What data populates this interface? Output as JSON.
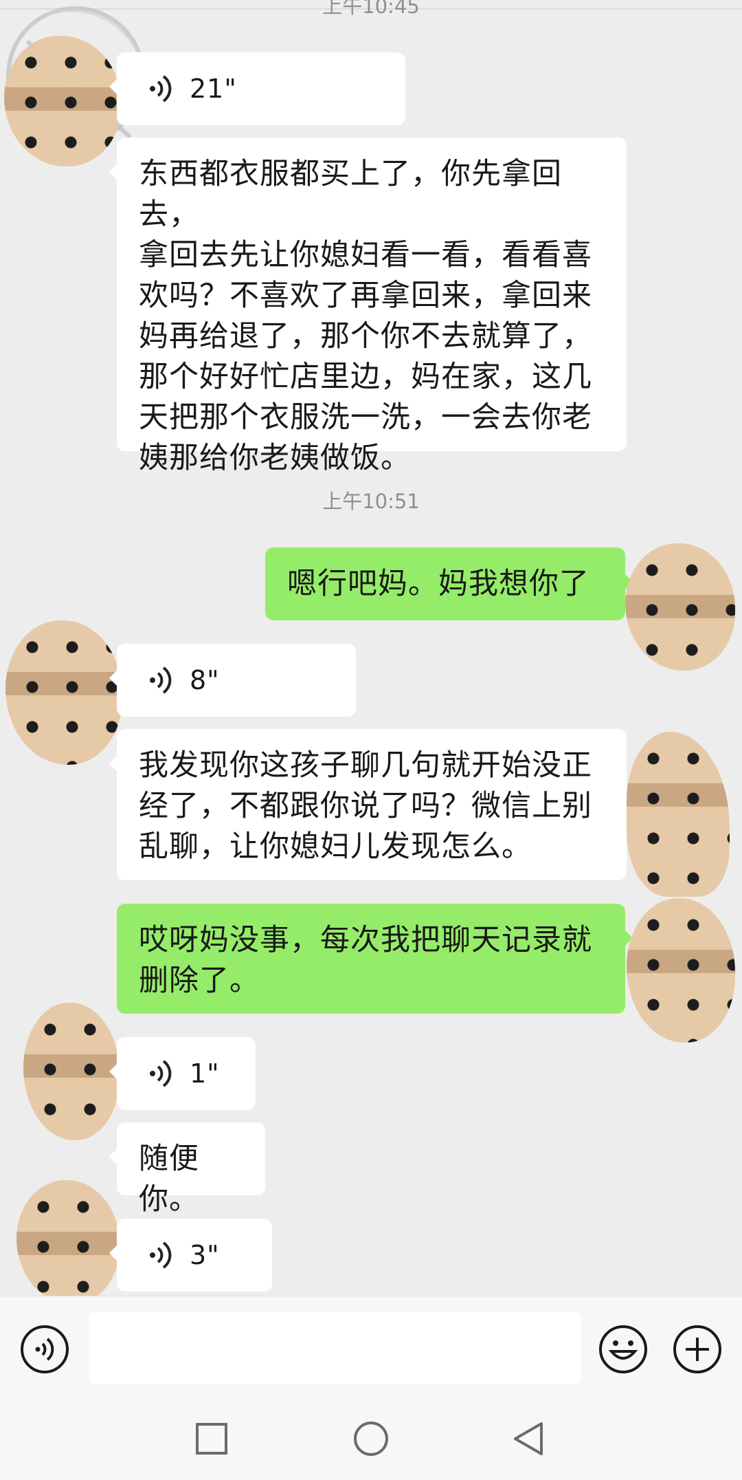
{
  "header_time_partial": "上午10:45",
  "messages": [
    {
      "type": "voice",
      "side": "left",
      "duration": "21\""
    },
    {
      "type": "text",
      "side": "left",
      "lines": [
        "东西都衣服都买上了，你先拿回去，",
        "拿回去先让你媳妇看一看，看看喜",
        "欢吗？不喜欢了再拿回来，拿回来",
        "妈再给退了，那个你不去就算了，",
        "那个好好忙店里边，妈在家，这几",
        "天把那个衣服洗一洗，一会去你老",
        "姨那给你老姨做饭。"
      ]
    },
    {
      "type": "timestamp",
      "text": "上午10:51"
    },
    {
      "type": "text",
      "side": "right",
      "lines": [
        "嗯行吧妈。妈我想你了"
      ]
    },
    {
      "type": "voice",
      "side": "left",
      "duration": "8\""
    },
    {
      "type": "text",
      "side": "left",
      "lines": [
        "我发现你这孩子聊几句就开始没正",
        "经了，不都跟你说了吗？微信上别",
        "乱聊，让你媳妇儿发现怎么。"
      ]
    },
    {
      "type": "text",
      "side": "right",
      "lines": [
        "哎呀妈没事，每次我把聊天记录就",
        "删除了。"
      ]
    },
    {
      "type": "voice",
      "side": "left",
      "duration": "1\""
    },
    {
      "type": "text",
      "side": "left",
      "lines": [
        "随便你。"
      ]
    },
    {
      "type": "voice",
      "side": "left",
      "duration": "3\""
    }
  ],
  "input": {
    "placeholder": ""
  },
  "icons": {
    "voice_toggle": "voice-input-icon",
    "emoji": "emoji-icon",
    "more": "plus-icon",
    "nav_recent": "square-nav-icon",
    "nav_home": "circle-nav-icon",
    "nav_back": "triangle-back-icon"
  },
  "colors": {
    "sent_bubble": "#95ec69",
    "received_bubble": "#ffffff",
    "background": "#ededed"
  }
}
